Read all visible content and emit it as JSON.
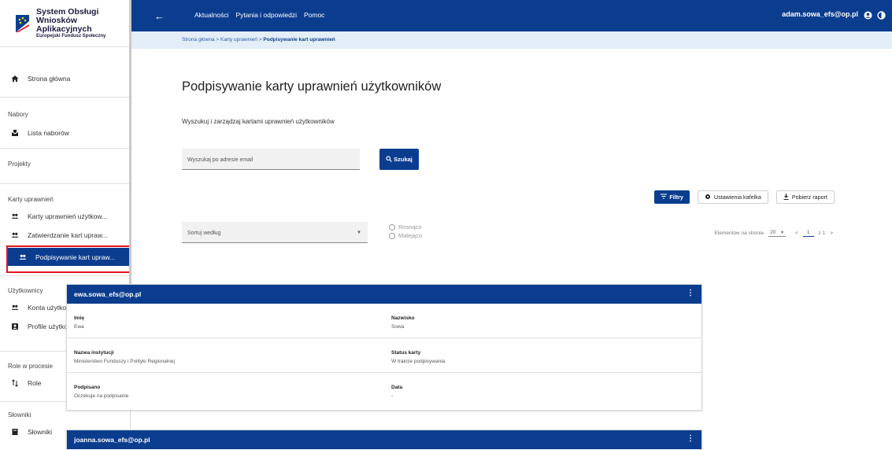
{
  "brand": {
    "title_line1": "System Obsługi",
    "title_line2": "Wniosków Aplikacyjnych",
    "subtitle": "Europejski Fundusz Społeczny"
  },
  "topbar": {
    "nav": [
      "Aktualności",
      "Pytania i odpowiedzi",
      "Pomoc"
    ],
    "user": "adam.sowa_efs@op.pl"
  },
  "breadcrumb": {
    "items": [
      "Strona główna",
      "Karty uprawnień"
    ],
    "current": "Podpisywanie kart uprawnień",
    "separator": ">"
  },
  "sidebar": {
    "home": "Strona główna",
    "sections": [
      {
        "heading": "Nabory",
        "items": [
          "Lista naborów"
        ]
      },
      {
        "heading": "Projekty",
        "items": []
      },
      {
        "heading": "Karty uprawnień",
        "items": [
          "Karty uprawnień użytkow...",
          "Zatwierdzanie kart upraw...",
          "Podpisywanie kart upraw..."
        ]
      },
      {
        "heading": "Użytkownicy",
        "items": [
          "Konta użytkowników",
          "Profile użytkowników"
        ]
      },
      {
        "heading": "Role w procesie",
        "items": [
          "Role"
        ]
      },
      {
        "heading": "Słowniki",
        "items": [
          "Słowniki"
        ]
      }
    ],
    "active_item": "Podpisywanie kart upraw..."
  },
  "page": {
    "title": "Podpisywanie karty uprawnień użytkowników",
    "description": "Wyszukuj i zarządzaj kartami uprawnień użytkowników",
    "search_placeholder": "Wyszukaj po adresie email",
    "search_button": "Szukaj",
    "filters_button": "Filtry",
    "tile_settings_button": "Ustawienia kafelka",
    "download_button": "Pobierz raport",
    "sort_label": "Sortuj według",
    "sort_asc": "Rosnąco",
    "sort_desc": "Malejąco",
    "per_page_label": "Elementów na stronie",
    "per_page_value": "20",
    "page_current": "1",
    "page_of": "z 1"
  },
  "cards": [
    {
      "email": "ewa.sowa_efs@op.pl",
      "fields": [
        {
          "label": "Imię",
          "value": "Ewa"
        },
        {
          "label": "Nazwisko",
          "value": "Sowa"
        },
        {
          "label": "Nazwa instytucji",
          "value": "Ministerstwo Funduszy i Polityki Regionalnej"
        },
        {
          "label": "Status karty",
          "value": "W trakcie podpisywania"
        },
        {
          "label": "Podpisano",
          "value": "Oczekuje na podpisanie"
        },
        {
          "label": "Data",
          "value": "-"
        }
      ]
    },
    {
      "email": "joanna.sowa_efs@op.pl"
    }
  ],
  "colors": {
    "primary": "#0b3d8f",
    "highlight": "#e0141e",
    "breadcrumb_bg": "#e4eef8"
  }
}
